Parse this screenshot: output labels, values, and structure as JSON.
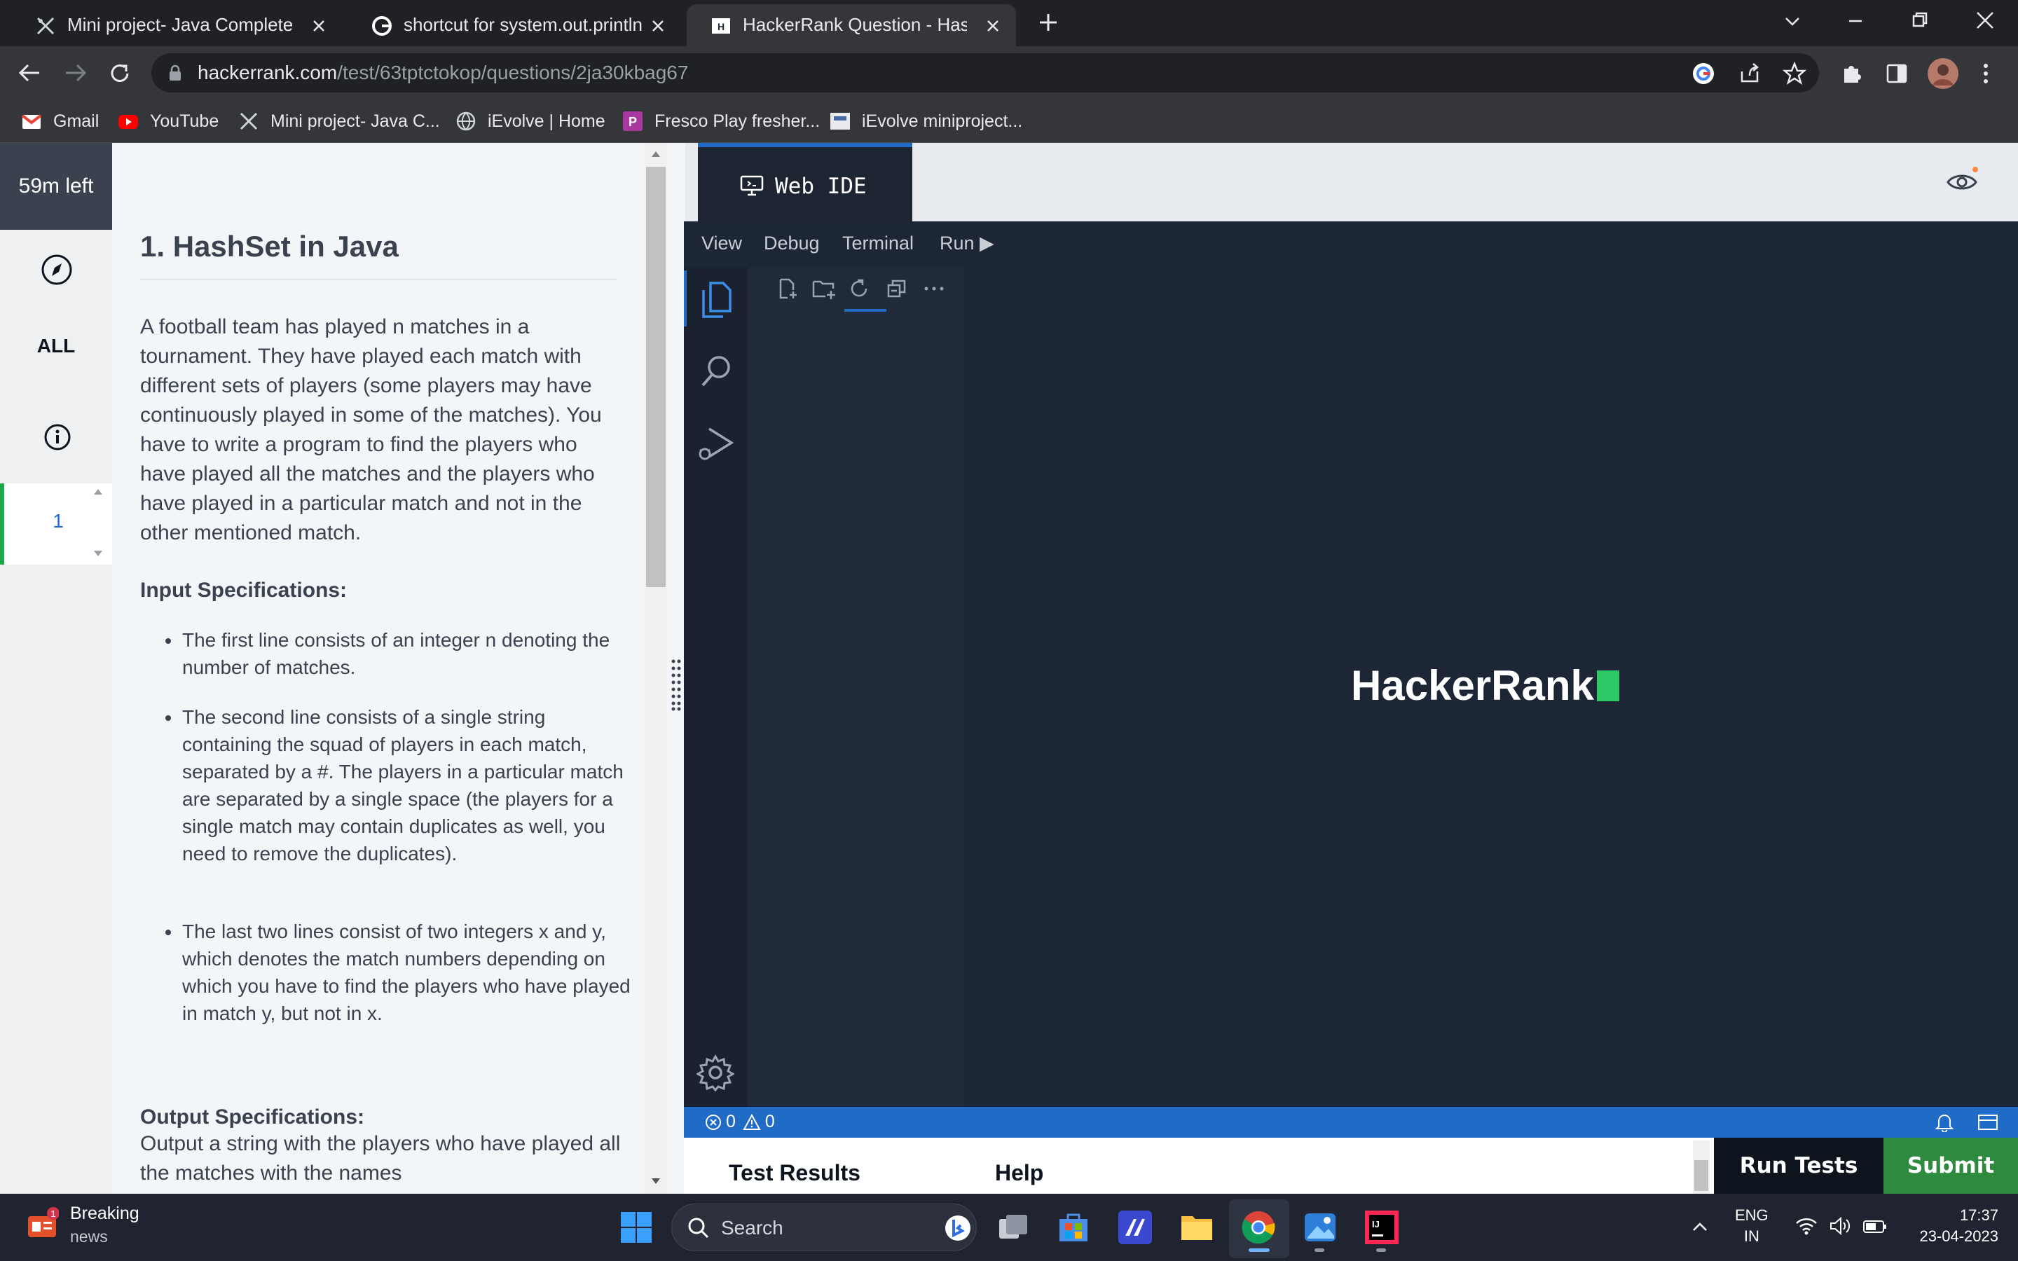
{
  "browser": {
    "tabs": [
      {
        "title": "Mini project- Java Complete Beg",
        "active": false
      },
      {
        "title": "shortcut for system.out.println in",
        "active": false
      },
      {
        "title": "HackerRank Question - HashSet i",
        "active": true
      }
    ],
    "url": {
      "host": "hackerrank.com",
      "path": "/test/63tptctokop/questions/2ja30kbag67"
    },
    "bookmarks": [
      "Gmail",
      "YouTube",
      "Mini project- Java C...",
      "iEvolve | Home",
      "Fresco Play fresher...",
      "iEvolve miniproject..."
    ],
    "accent": "#1f6bc6"
  },
  "sidebar": {
    "timer": "59m left",
    "all_label": "ALL",
    "question_number": "1"
  },
  "question": {
    "title": "1. HashSet in Java",
    "description": "A football team has played n matches in a tournament. They have played each match with different sets of players (some players may have continuously played in some of the matches). You have to write a program to find the players who have played all the matches and the players who have played in a particular match and not in the other mentioned match.",
    "input_heading": "Input Specifications:",
    "input_bullets": [
      "The first line consists of an integer n denoting the number of matches.",
      "The second line consists of a single string containing the squad of players in each match, separated by a #. The players in a particular match are separated by a single space (the players for a single match may contain duplicates as well, you need to remove the duplicates).",
      "The last two lines consist of two integers x and y, which denotes the match numbers depending on which you have to find the players who have played in match y, but not in x."
    ],
    "output_heading": "Output Specifications:",
    "output_text": "Output a string with the players who have played all the matches with the names"
  },
  "ide": {
    "tab_label": "Web IDE",
    "menu": [
      "View",
      "Debug",
      "Terminal",
      "Run ▶"
    ],
    "logo": "HackerRank",
    "status": {
      "errors": "0",
      "warnings": "0"
    },
    "bottom_tabs": {
      "results": "Test Results",
      "help": "Help"
    },
    "run_label": "Run Tests",
    "submit_label": "Submit"
  },
  "taskbar": {
    "news_title": "Breaking",
    "news_sub": "news",
    "news_badge": "1",
    "search": "Search",
    "lang_line1": "ENG",
    "lang_line2": "IN",
    "time": "17:37",
    "date": "23-04-2023"
  }
}
